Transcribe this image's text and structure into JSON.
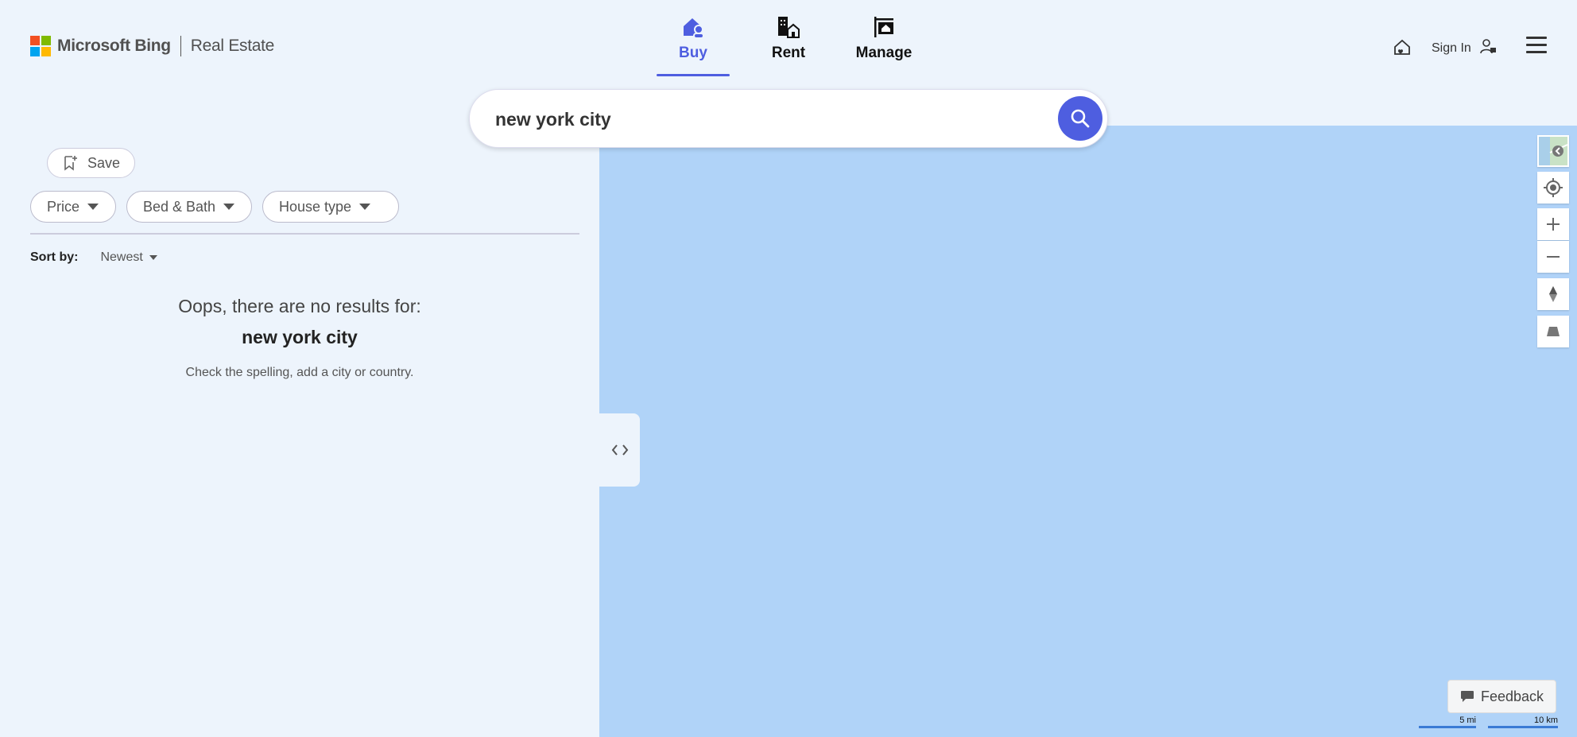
{
  "header": {
    "brand": "Microsoft Bing",
    "product": "Real Estate",
    "tabs": [
      {
        "label": "Buy",
        "icon": "house-person-icon",
        "active": true
      },
      {
        "label": "Rent",
        "icon": "building-house-icon",
        "active": false
      },
      {
        "label": "Manage",
        "icon": "signboard-house-icon",
        "active": false
      }
    ],
    "sign_in": "Sign In"
  },
  "search": {
    "value": "new york city"
  },
  "left_panel": {
    "save_label": "Save",
    "filters": [
      "Price",
      "Bed & Bath",
      "House type"
    ],
    "sort_label": "Sort by:",
    "sort_value": "Newest",
    "no_results": {
      "title": "Oops, there are no results for:",
      "query": "new york city",
      "hint": "Check the spelling, add a city or country."
    }
  },
  "map": {
    "feedback_label": "Feedback",
    "scale_mi": "5 mi",
    "scale_km": "10 km",
    "water_color": "#b0d3f8"
  },
  "colors": {
    "accent": "#4e5ee0",
    "background": "#edf4fc"
  }
}
